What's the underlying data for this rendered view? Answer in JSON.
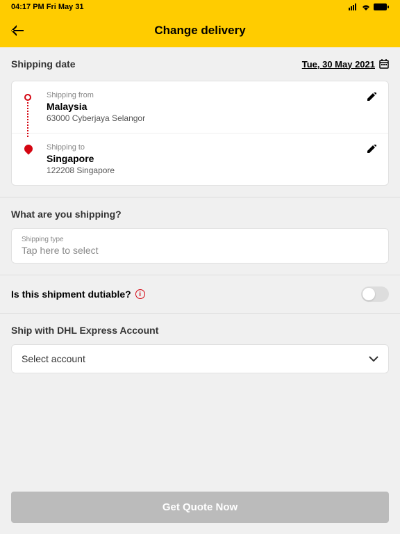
{
  "status": {
    "time": "04:17 PM Fri May 31"
  },
  "header": {
    "title": "Change delivery"
  },
  "shipping_date": {
    "label": "Shipping date",
    "value": "Tue, 30 May 2021"
  },
  "route": {
    "from": {
      "sublabel": "Shipping from",
      "country": "Malaysia",
      "address": "63000 Cyberjaya Selangor"
    },
    "to": {
      "sublabel": "Shipping to",
      "country": "Singapore",
      "address": "122208 Singapore"
    }
  },
  "shipping_type": {
    "question": "What are you shipping?",
    "label": "Shipping type",
    "placeholder": "Tap here to select"
  },
  "dutiable": {
    "question": "Is this shipment dutiable?",
    "enabled": false
  },
  "account": {
    "label": "Ship with DHL Express Account",
    "placeholder": "Select account"
  },
  "cta": {
    "label": "Get Quote Now"
  }
}
